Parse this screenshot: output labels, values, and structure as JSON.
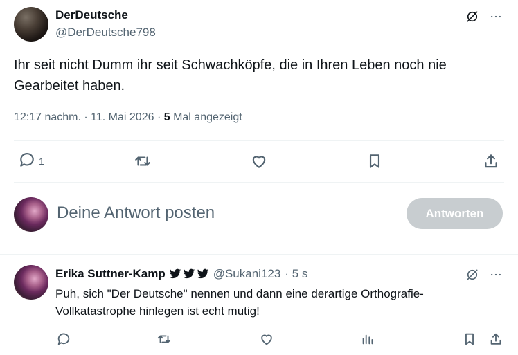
{
  "post": {
    "display_name": "DerDeutsche",
    "handle": "@DerDeutsche798",
    "text_line1": "Ihr seit nicht Dumm ihr seit Schwachköpfe, die in Ihren Leben noch nie",
    "text_line2": "Gearbeitet haben.",
    "time": "12:17 nachm. · 11. Mai 2026 · ",
    "views_count": "5",
    "views_label": " Mal angezeigt",
    "reply_count": "1"
  },
  "composer": {
    "placeholder": "Deine Antwort posten",
    "reply_button": "Antworten"
  },
  "reply": {
    "display_name": "Erika Suttner-Kamp",
    "handle": "@Sukani123",
    "time": "· 5 s",
    "text_line1": "Puh, sich \"Der Deutsche\" nennen und dann eine derartige Orthografie-",
    "text_line2": "Vollkatastrophe hinlegen ist echt mutig!"
  },
  "icons": [
    "grok-icon",
    "more-icon",
    "reply-icon",
    "repost-icon",
    "like-icon",
    "bookmark-icon",
    "share-icon",
    "views-icon",
    "bird-icon"
  ],
  "colors": {
    "text": "#0f1419",
    "secondary": "#536471",
    "button_disabled": "#c8cdd0",
    "divider": "#eff3f4"
  }
}
